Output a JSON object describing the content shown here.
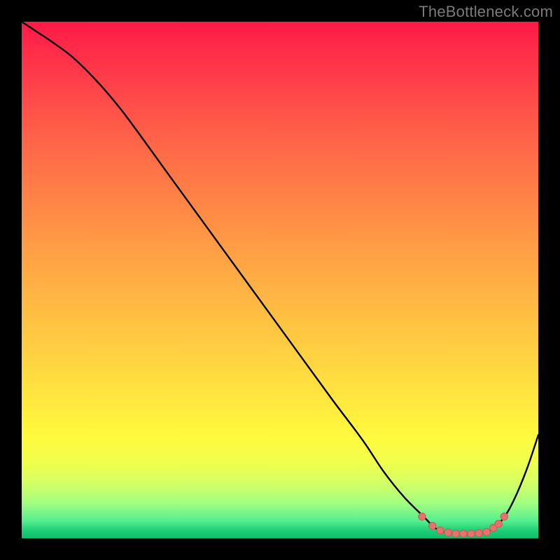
{
  "watermark": "TheBottleneck.com",
  "chart_data": {
    "type": "line",
    "title": "",
    "xlabel": "",
    "ylabel": "",
    "xlim": [
      0,
      100
    ],
    "ylim": [
      0,
      100
    ],
    "series": [
      {
        "name": "bottleneck-curve",
        "x": [
          0,
          3,
          6,
          10,
          15,
          20,
          28,
          36,
          44,
          52,
          60,
          66,
          70,
          74,
          78,
          80,
          82,
          84,
          86,
          88,
          90,
          92,
          94,
          96,
          98,
          100
        ],
        "y": [
          100,
          98,
          96,
          93,
          88,
          82,
          71,
          60,
          49,
          38,
          27,
          19,
          13,
          8,
          4,
          2,
          1.2,
          0.9,
          0.9,
          1.0,
          1.2,
          2.5,
          5,
          9,
          14,
          20
        ]
      }
    ],
    "markers": {
      "name": "highlight-dots",
      "points": [
        {
          "x": 77.5,
          "y": 4.2
        },
        {
          "x": 79.5,
          "y": 2.4
        },
        {
          "x": 81.0,
          "y": 1.5
        },
        {
          "x": 82.5,
          "y": 1.1
        },
        {
          "x": 84.0,
          "y": 0.9
        },
        {
          "x": 85.5,
          "y": 0.9
        },
        {
          "x": 87.0,
          "y": 0.9
        },
        {
          "x": 88.5,
          "y": 1.0
        },
        {
          "x": 90.0,
          "y": 1.2
        },
        {
          "x": 91.3,
          "y": 2.0
        },
        {
          "x": 92.3,
          "y": 2.8
        },
        {
          "x": 93.4,
          "y": 4.2
        }
      ]
    },
    "gradient_stops": [
      {
        "pos": 0,
        "color": "#ff1a48"
      },
      {
        "pos": 0.1,
        "color": "#ff3a4a"
      },
      {
        "pos": 0.22,
        "color": "#ff6148"
      },
      {
        "pos": 0.34,
        "color": "#ff8246"
      },
      {
        "pos": 0.46,
        "color": "#ffa344"
      },
      {
        "pos": 0.58,
        "color": "#ffc242"
      },
      {
        "pos": 0.7,
        "color": "#ffdf40"
      },
      {
        "pos": 0.8,
        "color": "#fff93e"
      },
      {
        "pos": 0.85,
        "color": "#f2ff4a"
      },
      {
        "pos": 0.89,
        "color": "#d7ff62"
      },
      {
        "pos": 0.93,
        "color": "#a6ff7e"
      },
      {
        "pos": 0.965,
        "color": "#5aef8f"
      },
      {
        "pos": 0.985,
        "color": "#1ccf76"
      },
      {
        "pos": 1.0,
        "color": "#0fbf6a"
      }
    ]
  },
  "style": {
    "line_color": "#000000",
    "marker_fill": "#e4736e",
    "marker_stroke": "#c95a56",
    "background": "#000000"
  }
}
